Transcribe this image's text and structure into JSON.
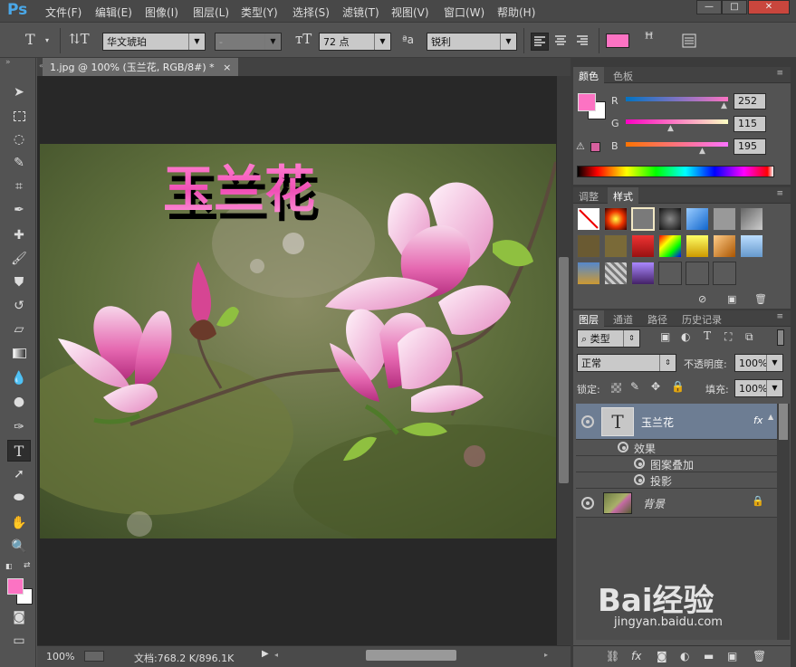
{
  "app": {
    "logo": "Ps"
  },
  "menu": [
    "文件(F)",
    "编辑(E)",
    "图像(I)",
    "图层(L)",
    "类型(Y)",
    "选择(S)",
    "滤镜(T)",
    "视图(V)",
    "窗口(W)",
    "帮助(H)"
  ],
  "window_buttons": [
    "—",
    "□",
    "✕"
  ],
  "options": {
    "font_family": "华文琥珀",
    "font_style": "-",
    "font_size": "72 点",
    "aa_label": "ªa",
    "antialias": "锐利",
    "text_color": "#fc73c3"
  },
  "document": {
    "tab_title": "1.jpg @ 100% (玉兰花, RGB/8#) *",
    "close": "×",
    "text_layer_content": "玉兰花"
  },
  "status": {
    "zoom": "100%",
    "doc_info": "文档:768.2 K/896.1K"
  },
  "color_panel": {
    "tabs": [
      "颜色",
      "色板"
    ],
    "channels": [
      {
        "label": "R",
        "value": "252",
        "pos": 0.988
      },
      {
        "label": "G",
        "value": "115",
        "pos": 0.451
      },
      {
        "label": "B",
        "value": "195",
        "pos": 0.765
      }
    ],
    "fg": "#fc73c3",
    "bg": "#ffffff"
  },
  "styles_panel": {
    "tabs": [
      "调整",
      "样式"
    ]
  },
  "layers_panel": {
    "tabs": [
      "图层",
      "通道",
      "路径",
      "历史记录"
    ],
    "filter": "类型",
    "blend_mode": "正常",
    "opacity_label": "不透明度:",
    "opacity": "100%",
    "lock_label": "锁定:",
    "fill_label": "填充:",
    "fill": "100%",
    "layers": [
      {
        "name": "玉兰花",
        "type": "text",
        "fx": "fx"
      },
      {
        "name": "背景",
        "type": "image"
      }
    ],
    "effects_label": "效果",
    "effects": [
      "图案叠加",
      "投影"
    ]
  },
  "watermark": {
    "brand": "Bai经验",
    "url": "jingyan.baidu.com"
  }
}
